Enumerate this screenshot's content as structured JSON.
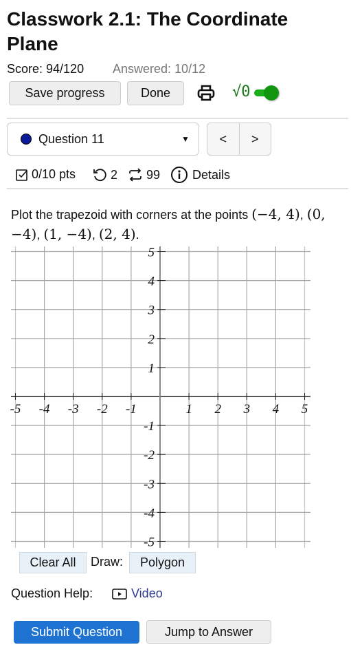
{
  "header": {
    "title": "Classwork 2.1: The Coordinate Plane",
    "score": "Score: 94/120",
    "answered": "Answered: 10/12",
    "save_label": "Save progress",
    "done_label": "Done",
    "math_toggle_label": "√0",
    "math_toggle_on": true,
    "colors": {
      "toggle": "#1a9c1a",
      "math_label": "#1a7a1a"
    }
  },
  "question_nav": {
    "selected": "Question 11",
    "status_dot_color": "#0a1a9a",
    "prev_label": "<",
    "next_label": ">"
  },
  "meta": {
    "points": "0/10 pts",
    "retries": "2",
    "attempts": "99",
    "details_label": "Details"
  },
  "question": {
    "prompt_text": "Plot the trapezoid with corners at the points",
    "points": [
      "(−4, 4)",
      "(0, −4)",
      "(1, −4)",
      "(2, 4)"
    ]
  },
  "graph": {
    "x_range": [
      -5,
      5
    ],
    "y_range": [
      -5,
      5
    ],
    "x_ticks": [
      "-5",
      "-4",
      "-3",
      "-2",
      "-1",
      "1",
      "2",
      "3",
      "4",
      "5"
    ],
    "y_ticks": [
      "5",
      "4",
      "3",
      "2",
      "1",
      "-1",
      "-2",
      "-3",
      "-4",
      "-5"
    ],
    "clear_label": "Clear All",
    "draw_label": "Draw:",
    "tool_label": "Polygon"
  },
  "help": {
    "label": "Question Help:",
    "video_label": "Video",
    "link_color": "#2e3a8c"
  },
  "actions": {
    "submit_label": "Submit Question",
    "jump_label": "Jump to Answer",
    "submit_color": "#1e73d2"
  }
}
